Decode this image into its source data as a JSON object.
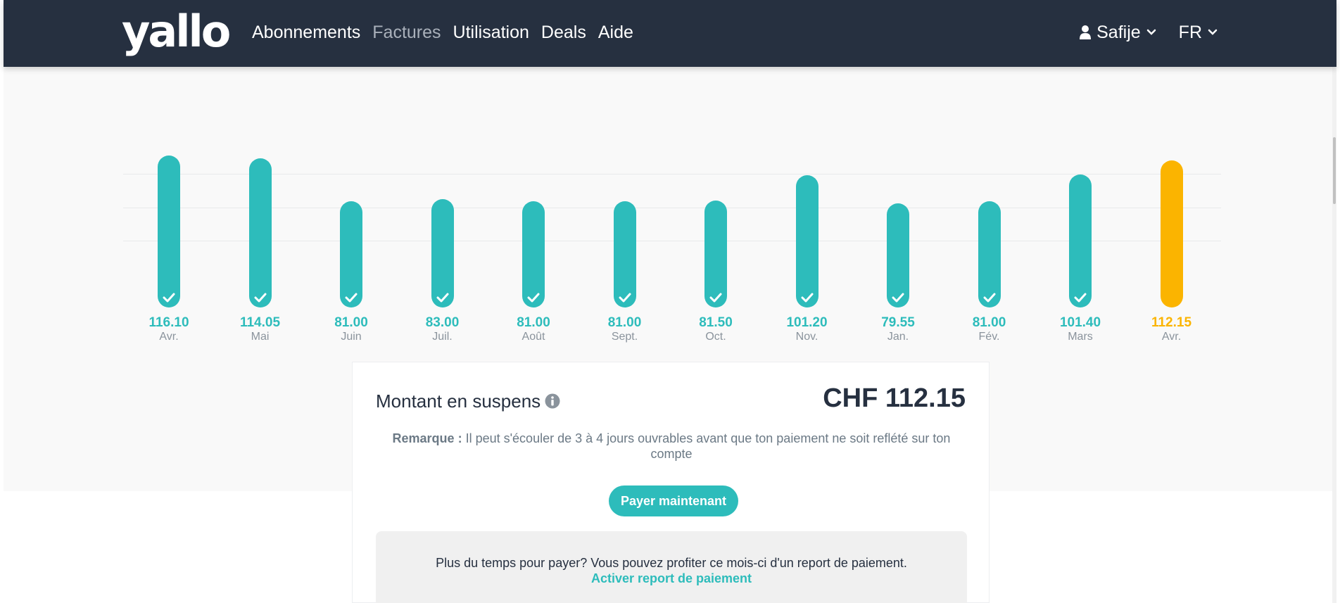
{
  "nav": {
    "logo": "yallo",
    "links": [
      "Abonnements",
      "Factures",
      "Utilisation",
      "Deals",
      "Aide"
    ],
    "active_link": "Factures",
    "user_name": "Safije",
    "language": "FR",
    "colors": {
      "background": "#263040",
      "active_link": "#a9b0ba"
    }
  },
  "chart_data": {
    "type": "bar",
    "categories": [
      "Avr.",
      "Mai",
      "Juin",
      "Juil.",
      "Août",
      "Sept.",
      "Oct.",
      "Nov.",
      "Jan.",
      "Fév.",
      "Mars",
      "Avr."
    ],
    "values": [
      116.1,
      114.05,
      81.0,
      83.0,
      81.0,
      81.0,
      81.5,
      101.2,
      79.55,
      81.0,
      101.4,
      112.15
    ],
    "value_labels": [
      "116.10",
      "114.05",
      "81.00",
      "83.00",
      "81.00",
      "81.00",
      "81.50",
      "101.20",
      "79.55",
      "81.00",
      "101.40",
      "112.15"
    ],
    "paid": [
      true,
      true,
      true,
      true,
      true,
      true,
      true,
      true,
      true,
      true,
      true,
      false
    ],
    "colors": {
      "paid": "#2dbcbb",
      "pending": "#fbb400"
    },
    "grid": true,
    "xlabel": "",
    "ylabel": ""
  },
  "outstanding": {
    "title": "Montant en suspens",
    "amount": "CHF 112.15",
    "note_label": "Remarque :",
    "note_text": "Il peut s'écouler de 3 à 4 jours ouvrables avant que ton paiement ne soit reflété sur ton compte",
    "pay_button": "Payer maintenant",
    "defer_text": "Plus du temps pour payer? Vous pouvez profiter ce mois-ci d'un report de paiement.",
    "defer_link": "Activer report de paiement"
  }
}
